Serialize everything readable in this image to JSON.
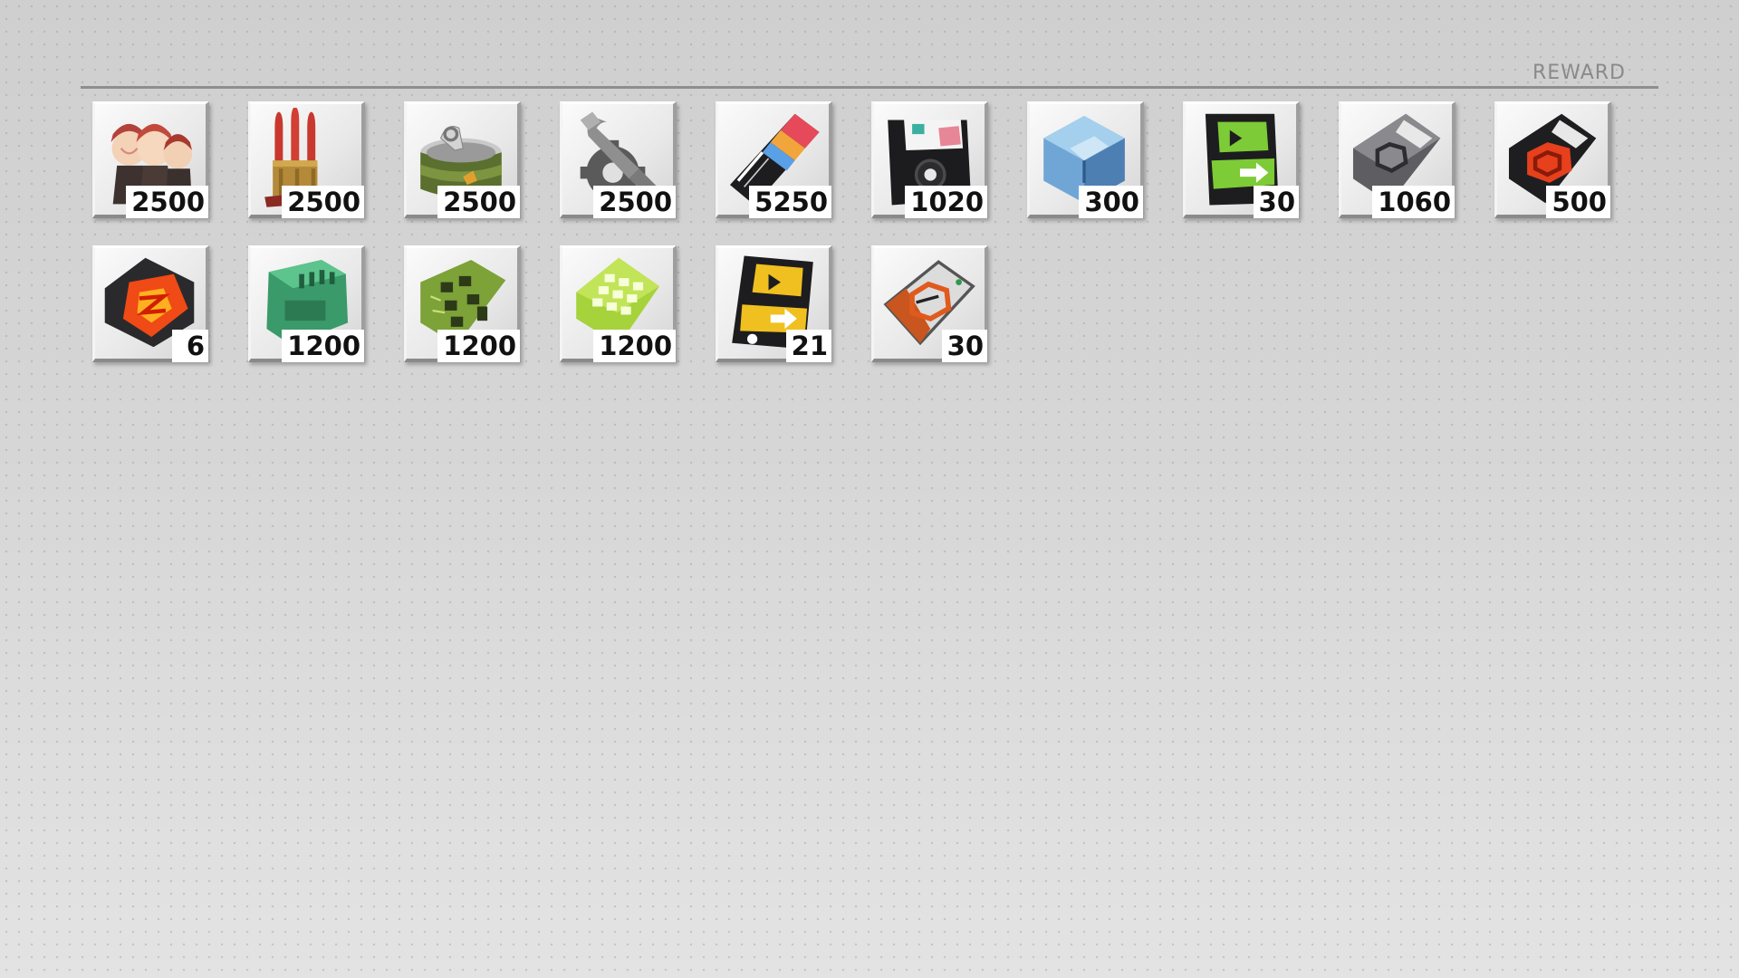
{
  "header": {
    "title": "REWARD"
  },
  "items": [
    {
      "icon": "dolls-icon",
      "count": "2500"
    },
    {
      "icon": "ammo-icon",
      "count": "2500"
    },
    {
      "icon": "ration-can-icon",
      "count": "2500"
    },
    {
      "icon": "wrench-gear-icon",
      "count": "2500"
    },
    {
      "icon": "singlechase-card-icon",
      "count": "5250"
    },
    {
      "icon": "floppy-disk-icon",
      "count": "1020"
    },
    {
      "icon": "blue-cube-icon",
      "count": "300"
    },
    {
      "icon": "green-ticket-icon",
      "count": "30"
    },
    {
      "icon": "wave-grey-chip-icon",
      "count": "1060"
    },
    {
      "icon": "wave-orange-chip-icon",
      "count": "500"
    },
    {
      "icon": "wave-red-core-icon",
      "count": "6"
    },
    {
      "icon": "green-sd-card-icon",
      "count": "1200"
    },
    {
      "icon": "green-circuit-board-icon",
      "count": "1200"
    },
    {
      "icon": "lime-chip-icon",
      "count": "1200"
    },
    {
      "icon": "yellow-ticket-icon",
      "count": "21"
    },
    {
      "icon": "wave-badge-icon",
      "count": "30"
    }
  ]
}
